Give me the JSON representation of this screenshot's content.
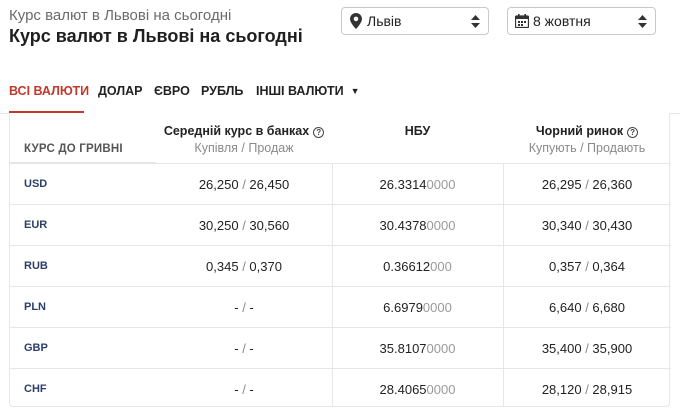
{
  "header": {
    "breadcrumb": "Курс валют в Львові на сьогодні",
    "title": "Курс валют в Львові на сьогодні",
    "city": "Львів",
    "date": "8 жовтня"
  },
  "tabs": [
    {
      "label": "ВСІ ВАЛЮТИ",
      "active": true
    },
    {
      "label": "ДОЛАР"
    },
    {
      "label": "ЄВРО"
    },
    {
      "label": "РУБЛЬ"
    },
    {
      "label": "ІНШІ ВАЛЮТИ"
    }
  ],
  "table": {
    "first_header": "КУРС ДО ГРИВНІ",
    "columns": [
      {
        "title": "Середній курс в банках",
        "subtitle": "Купівля / Продаж",
        "info": true
      },
      {
        "title": "НБУ",
        "subtitle": "",
        "info": false
      },
      {
        "title": "Чорний ринок",
        "subtitle": "Купують / Продають",
        "info": true
      }
    ],
    "rows": [
      {
        "code": "USD",
        "bank_buy": "26,250",
        "bank_sell": "26,450",
        "nbu": "26.3314",
        "nbu_tail": "0000",
        "black_buy": "26,295",
        "black_sell": "26,360"
      },
      {
        "code": "EUR",
        "bank_buy": "30,250",
        "bank_sell": "30,560",
        "nbu": "30.4378",
        "nbu_tail": "0000",
        "black_buy": "30,340",
        "black_sell": "30,430"
      },
      {
        "code": "RUB",
        "bank_buy": "0,345",
        "bank_sell": "0,370",
        "nbu": "0.36612",
        "nbu_tail": "000",
        "black_buy": "0,357",
        "black_sell": "0,364"
      },
      {
        "code": "PLN",
        "bank_buy": "-",
        "bank_sell": "-",
        "nbu": "6.6979",
        "nbu_tail": "0000",
        "black_buy": "6,640",
        "black_sell": "6,680"
      },
      {
        "code": "GBP",
        "bank_buy": "-",
        "bank_sell": "-",
        "nbu": "35.8107",
        "nbu_tail": "0000",
        "black_buy": "35,400",
        "black_sell": "35,900"
      },
      {
        "code": "CHF",
        "bank_buy": "-",
        "bank_sell": "-",
        "nbu": "28.4065",
        "nbu_tail": "0000",
        "black_buy": "28,120",
        "black_sell": "28,915"
      }
    ]
  },
  "icons": {
    "city": "map-pin-icon",
    "date": "calendar-icon",
    "info": "info-icon",
    "dropdown": "caret-down-icon"
  },
  "colors": {
    "accent": "#c0392b",
    "code": "#2c3e6b"
  }
}
